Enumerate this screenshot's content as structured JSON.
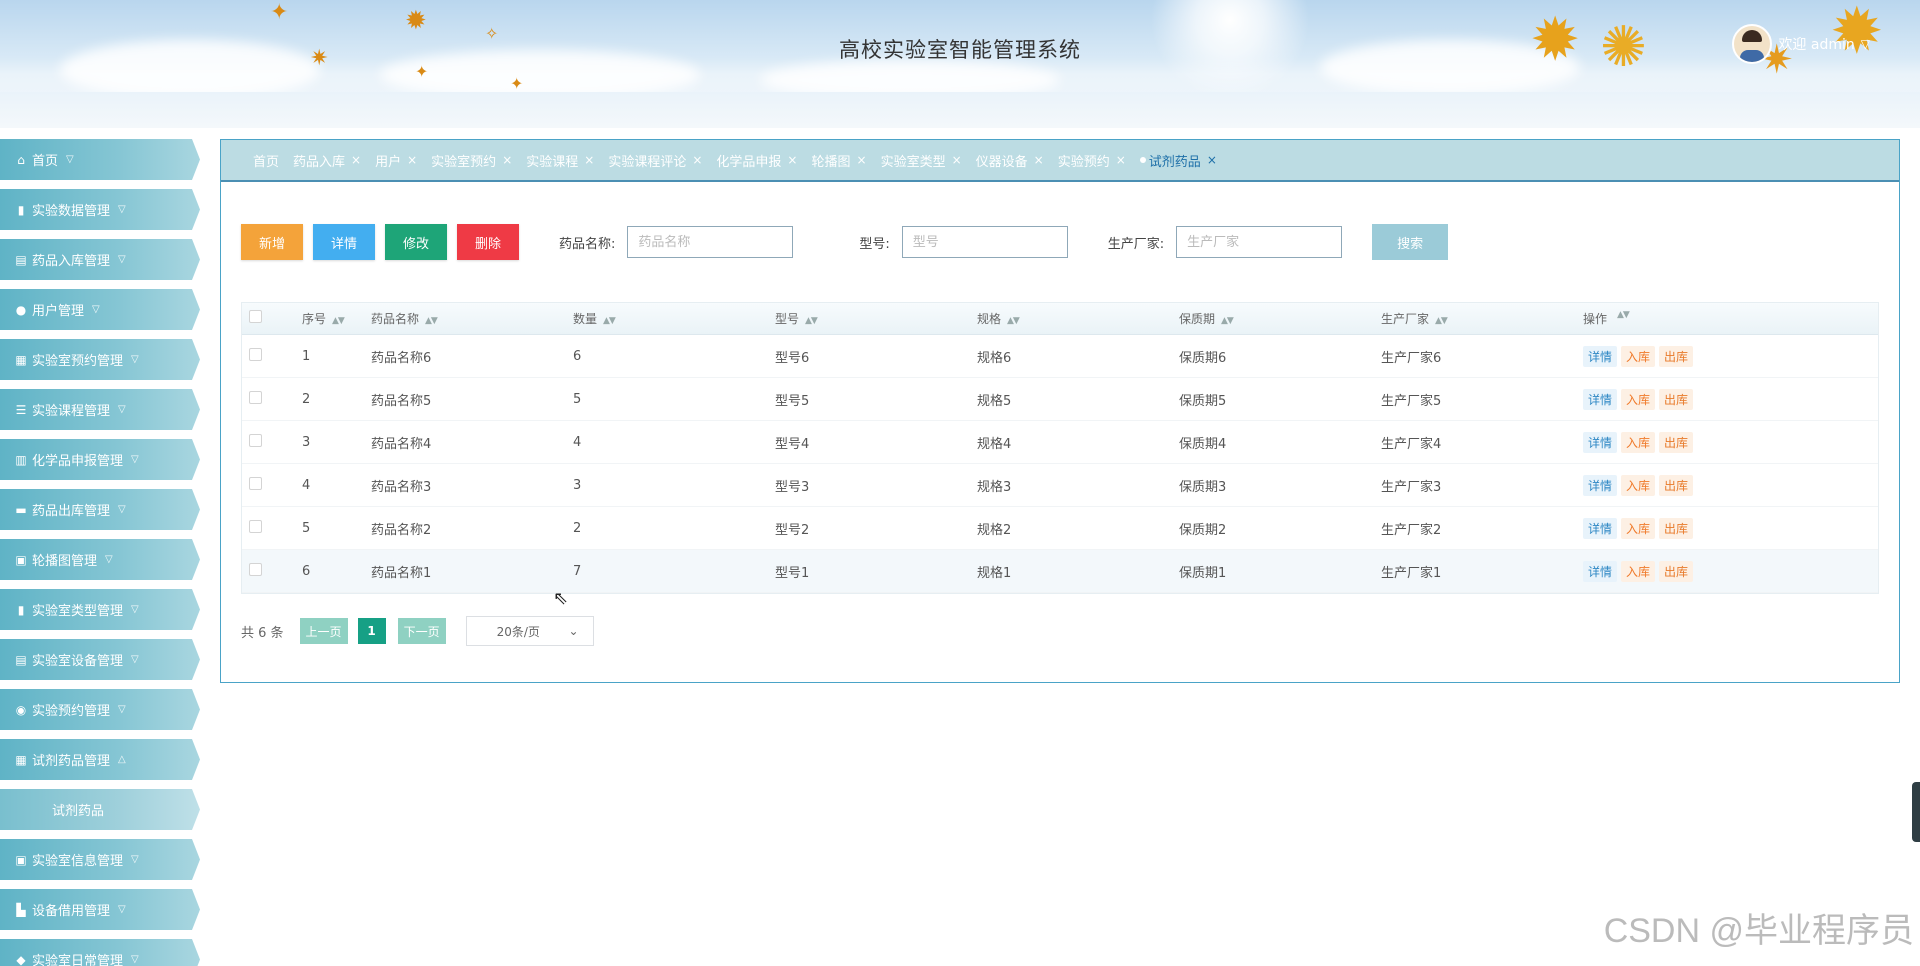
{
  "header": {
    "title": "高校实验室智能管理系统",
    "welcome": "欢迎 admin"
  },
  "sidebar": {
    "items": [
      {
        "label": "首页",
        "icon": "home-icon",
        "glyph": "⌂",
        "caret": "▽"
      },
      {
        "label": "实验数据管理",
        "icon": "bookmark-icon",
        "glyph": "▮",
        "caret": "▽"
      },
      {
        "label": "药品入库管理",
        "icon": "image-icon",
        "glyph": "▤",
        "caret": "▽"
      },
      {
        "label": "用户管理",
        "icon": "user-icon",
        "glyph": "●",
        "caret": "▽"
      },
      {
        "label": "实验室预约管理",
        "icon": "grid-icon",
        "glyph": "▦",
        "caret": "▽"
      },
      {
        "label": "实验课程管理",
        "icon": "list-icon",
        "glyph": "☰",
        "caret": "▽"
      },
      {
        "label": "化学品申报管理",
        "icon": "layout-icon",
        "glyph": "▥",
        "caret": "▽"
      },
      {
        "label": "药品出库管理",
        "icon": "panel-icon",
        "glyph": "▬",
        "caret": "▽"
      },
      {
        "label": "轮播图管理",
        "icon": "briefcase-icon",
        "glyph": "▣",
        "caret": "▽"
      },
      {
        "label": "实验室类型管理",
        "icon": "columns-icon",
        "glyph": "▮",
        "caret": "▽"
      },
      {
        "label": "实验室设备管理",
        "icon": "server-icon",
        "glyph": "▤",
        "caret": "▽"
      },
      {
        "label": "实验预约管理",
        "icon": "circle-icon",
        "glyph": "◉",
        "caret": "▽"
      },
      {
        "label": "试剂药品管理",
        "icon": "bag-icon",
        "glyph": "▦",
        "caret": "△"
      },
      {
        "label": "试剂药品",
        "icon": "",
        "glyph": "",
        "caret": "",
        "sub": true
      },
      {
        "label": "实验室信息管理",
        "icon": "id-card-icon",
        "glyph": "▣",
        "caret": "▽"
      },
      {
        "label": "设备借用管理",
        "icon": "tag-icon",
        "glyph": "▙",
        "caret": "▽"
      },
      {
        "label": "实验室日常管理",
        "icon": "drop-icon",
        "glyph": "◆",
        "caret": "▽"
      }
    ]
  },
  "tabs": [
    {
      "label": "首页",
      "closable": false
    },
    {
      "label": "药品入库",
      "closable": true
    },
    {
      "label": "用户",
      "closable": true
    },
    {
      "label": "实验室预约",
      "closable": true
    },
    {
      "label": "实验课程",
      "closable": true
    },
    {
      "label": "实验课程评论",
      "closable": true
    },
    {
      "label": "化学品申报",
      "closable": true
    },
    {
      "label": "轮播图",
      "closable": true
    },
    {
      "label": "实验室类型",
      "closable": true
    },
    {
      "label": "仪器设备",
      "closable": true
    },
    {
      "label": "实验预约",
      "closable": true
    },
    {
      "label": "试剂药品",
      "closable": true,
      "current": true
    }
  ],
  "toolbar": {
    "add": "新增",
    "detail": "详情",
    "edit": "修改",
    "delete": "删除",
    "search": "搜索"
  },
  "filters": {
    "name_label": "药品名称:",
    "name_placeholder": "药品名称",
    "model_label": "型号:",
    "model_placeholder": "型号",
    "maker_label": "生产厂家:",
    "maker_placeholder": "生产厂家"
  },
  "table": {
    "headers": [
      "序号",
      "药品名称",
      "数量",
      "型号",
      "规格",
      "保质期",
      "生产厂家",
      "操作"
    ],
    "rows": [
      [
        "1",
        "药品名称6",
        "6",
        "型号6",
        "规格6",
        "保质期6",
        "生产厂家6"
      ],
      [
        "2",
        "药品名称5",
        "5",
        "型号5",
        "规格5",
        "保质期5",
        "生产厂家5"
      ],
      [
        "3",
        "药品名称4",
        "4",
        "型号4",
        "规格4",
        "保质期4",
        "生产厂家4"
      ],
      [
        "4",
        "药品名称3",
        "3",
        "型号3",
        "规格3",
        "保质期3",
        "生产厂家3"
      ],
      [
        "5",
        "药品名称2",
        "2",
        "型号2",
        "规格2",
        "保质期2",
        "生产厂家2"
      ],
      [
        "6",
        "药品名称1",
        "7",
        "型号1",
        "规格1",
        "保质期1",
        "生产厂家1"
      ]
    ],
    "ops": {
      "detail": "详情",
      "in": "入库",
      "out": "出库"
    }
  },
  "pagination": {
    "total": "共 6 条",
    "prev": "上一页",
    "page": "1",
    "next": "下一页",
    "size": "20条/页"
  },
  "watermark": "CSDN @毕业程序员",
  "colors": {
    "add": "#f4a33a",
    "detail": "#43aef0",
    "edit": "#1ea578",
    "delete": "#ef3a45",
    "sidebar": "#5fb3c6"
  }
}
